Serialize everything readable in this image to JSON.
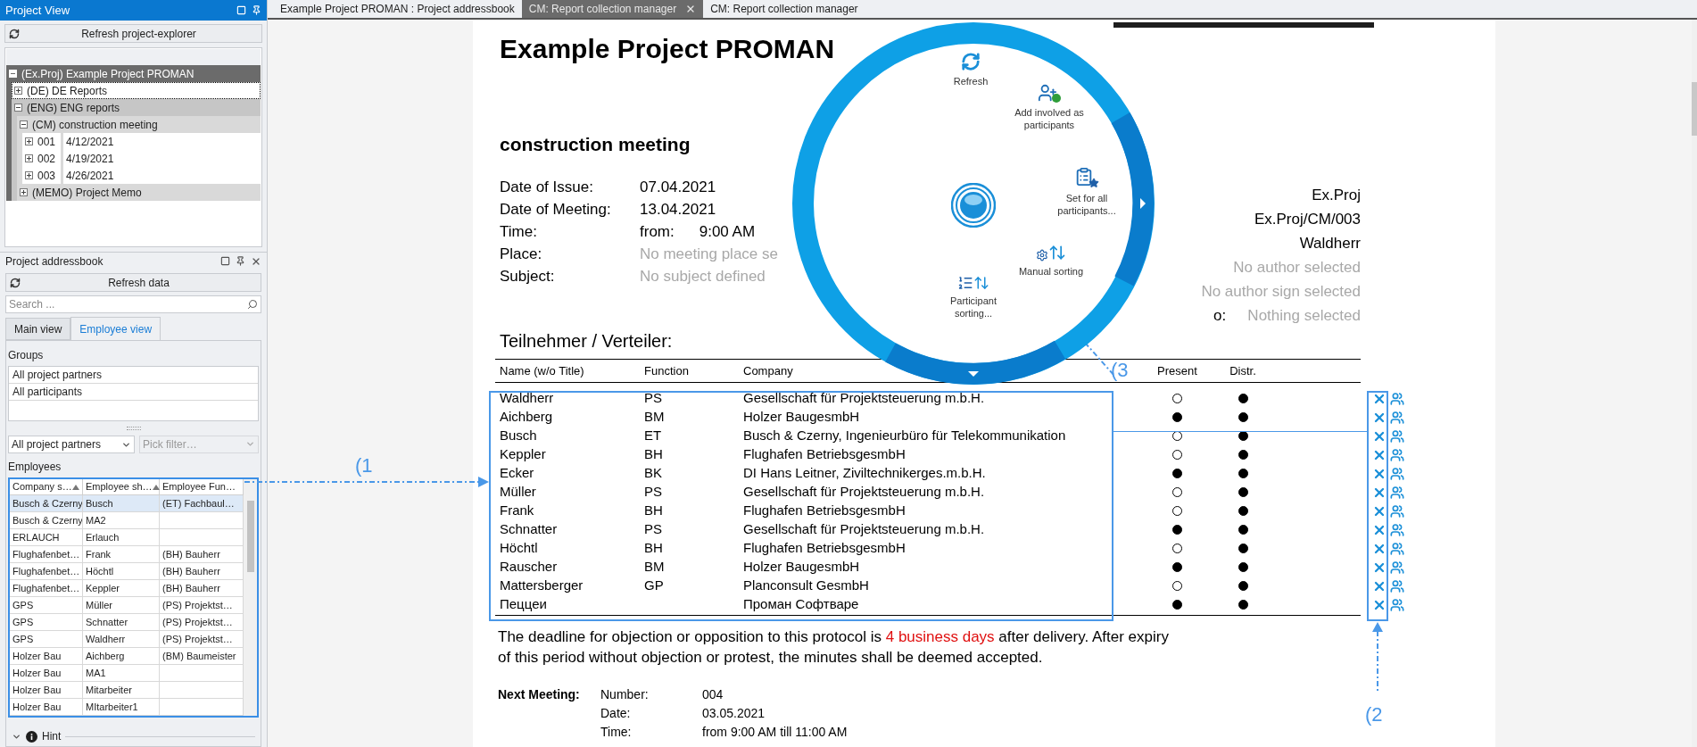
{
  "project_view": {
    "title": "Project View",
    "refresh_button": "Refresh project-explorer",
    "tree": [
      {
        "label": "(Ex.Proj) Example Project PROMAN",
        "expanded": true,
        "selected": false,
        "children": [
          {
            "label": "(DE) DE Reports",
            "expanded": false,
            "selected": true
          },
          {
            "label": "(ENG) ENG reports",
            "expanded": true,
            "selected": false,
            "children": [
              {
                "label": "(CM) construction meeting",
                "expanded": true,
                "selected": false,
                "children": [
                  {
                    "label": "001",
                    "date": "4/12/2021",
                    "expanded": false,
                    "selected": false
                  },
                  {
                    "label": "002",
                    "date": "4/19/2021",
                    "expanded": false,
                    "selected": false
                  },
                  {
                    "label": "003",
                    "date": "4/26/2021",
                    "expanded": false,
                    "selected": false
                  }
                ]
              },
              {
                "label": "(MEMO) Project Memo",
                "expanded": false,
                "selected": false
              }
            ]
          }
        ]
      }
    ]
  },
  "addressbook": {
    "title": "Project addressbook",
    "refresh_button": "Refresh data",
    "search": {
      "placeholder": "Search ..."
    },
    "tabs": [
      {
        "label": "Main view",
        "selected": false
      },
      {
        "label": "Employee view",
        "selected": true
      }
    ],
    "groups_label": "Groups",
    "groups": [
      "All project partners",
      "All participants"
    ],
    "filter": "All project partners",
    "pick_filter": {
      "placeholder": "Pick filter…"
    },
    "employees_label": "Employees",
    "employees": {
      "columns": [
        {
          "label": "Company s…",
          "sorted": true
        },
        {
          "label": "Employee sh…",
          "sorted": true
        },
        {
          "label": "Employee Fun…"
        }
      ],
      "rows": [
        {
          "cells": [
            "Busch & Czerny",
            "Busch",
            "(ET) Fachbaul…"
          ],
          "selected": true
        },
        {
          "cells": [
            "Busch & Czerny",
            "MA2",
            ""
          ],
          "selected": false
        },
        {
          "cells": [
            "ERLAUCH",
            "Erlauch",
            ""
          ],
          "selected": false
        },
        {
          "cells": [
            "Flughafenbet…",
            "Frank",
            "(BH) Bauherr"
          ],
          "selected": false
        },
        {
          "cells": [
            "Flughafenbet…",
            "Höchtl",
            "(BH) Bauherr"
          ],
          "selected": false
        },
        {
          "cells": [
            "Flughafenbet…",
            "Keppler",
            "(BH) Bauherr"
          ],
          "selected": false
        },
        {
          "cells": [
            "GPS",
            "Müller",
            "(PS) Projektst…"
          ],
          "selected": false
        },
        {
          "cells": [
            "GPS",
            "Schnatter",
            "(PS) Projektst…"
          ],
          "selected": false
        },
        {
          "cells": [
            "GPS",
            "Waldherr",
            "(PS) Projektst…"
          ],
          "selected": false
        },
        {
          "cells": [
            "Holzer Bau",
            "Aichberg",
            "(BM) Baumeister"
          ],
          "selected": false
        },
        {
          "cells": [
            "Holzer Bau",
            "MA1",
            ""
          ],
          "selected": false
        },
        {
          "cells": [
            "Holzer Bau",
            "Mitarbeiter",
            ""
          ],
          "selected": false
        },
        {
          "cells": [
            "Holzer Bau",
            "MItarbeiter1",
            ""
          ],
          "selected": false
        }
      ]
    },
    "hint": "Hint"
  },
  "document_tabs": [
    {
      "label": "Example Project PROMAN : Project addressbook",
      "selected": false
    },
    {
      "label": "CM: Report collection manager",
      "selected": true
    },
    {
      "label": "CM: Report collection manager",
      "selected": false
    }
  ],
  "report": {
    "title": "Example Project PROMAN",
    "subtitle": "construction meeting",
    "info": [
      {
        "label": "Date of Issue:",
        "value": "07.04.2021",
        "unset": false
      },
      {
        "label": "Date of Meeting:",
        "value": "13.04.2021",
        "unset": false
      },
      {
        "label": "Time:",
        "value": "from:",
        "extra": "9:00 AM",
        "unset": false
      },
      {
        "label": "Place:",
        "value": "No meeting place se",
        "unset": true
      },
      {
        "label": "Subject:",
        "value": "No subject defined",
        "unset": true
      }
    ],
    "right_info": [
      {
        "value": "Ex.Proj",
        "unset": false
      },
      {
        "value": "Ex.Proj/CM/003",
        "unset": false
      },
      {
        "value": "Waldherr",
        "unset": false
      },
      {
        "value": "No author selected",
        "unset": true
      },
      {
        "value": "No author sign selected",
        "unset": true
      },
      {
        "label": "o:",
        "value": "Nothing selected",
        "unset": true
      }
    ],
    "participants_heading": "Teilnehmer / Verteiler:",
    "columns": [
      "Name (w/o Title)",
      "Function",
      "Company",
      "Present",
      "Distr."
    ],
    "participants": [
      {
        "name": "Waldherr",
        "function": "PS",
        "company": "Gesellschaft für Projektsteuerung m.b.H.",
        "present": false,
        "distr": true
      },
      {
        "name": "Aichberg",
        "function": "BM",
        "company": "Holzer BaugesmbH",
        "present": true,
        "distr": true
      },
      {
        "name": "Busch",
        "function": "ET",
        "company": "Busch & Czerny, Ingenieurbüro für Telekommunikation",
        "present": false,
        "distr": true
      },
      {
        "name": "Keppler",
        "function": "BH",
        "company": "Flughafen BetriebsgesmbH",
        "present": false,
        "distr": true
      },
      {
        "name": "Ecker",
        "function": "BK",
        "company": "DI Hans Leitner, Ziviltechnikerges.m.b.H.",
        "present": true,
        "distr": true
      },
      {
        "name": "Müller",
        "function": "PS",
        "company": "Gesellschaft für Projektsteuerung m.b.H.",
        "present": false,
        "distr": true
      },
      {
        "name": "Frank",
        "function": "BH",
        "company": "Flughafen BetriebsgesmbH",
        "present": false,
        "distr": true
      },
      {
        "name": "Schnatter",
        "function": "PS",
        "company": "Gesellschaft für Projektsteuerung m.b.H.",
        "present": true,
        "distr": true
      },
      {
        "name": "Höchtl",
        "function": "BH",
        "company": "Flughafen BetriebsgesmbH",
        "present": false,
        "distr": true
      },
      {
        "name": "Rauscher",
        "function": "BM",
        "company": "Holzer BaugesmbH",
        "present": true,
        "distr": true
      },
      {
        "name": "Mattersberger",
        "function": "GP",
        "company": "Planconsult GesmbH",
        "present": false,
        "distr": true
      },
      {
        "name": "Пеццеи",
        "company": "Проман Софтваре",
        "present": true,
        "distr": true
      }
    ],
    "deadline": [
      {
        "text": "The deadline for objection or opposition to this protocol is ",
        "highlight": false
      },
      {
        "text": "4 business days",
        "highlight": true
      },
      {
        "text": " after delivery. After expiry of this period without objection or protest, the minutes shall be deemed accepted.",
        "highlight": false
      }
    ],
    "next_meeting": {
      "label": "Next Meeting:",
      "rows": [
        {
          "label": "Number:",
          "value": "004"
        },
        {
          "label": "Date:",
          "value": "03.05.2021"
        },
        {
          "label": "Time:",
          "value": "from 9:00 AM till 11:00 AM"
        }
      ]
    }
  },
  "radial_menu": {
    "items": [
      {
        "kind": "refresh",
        "label": "Refresh"
      },
      {
        "kind": "add",
        "label": "Add involved as participants"
      },
      {
        "kind": "set_all",
        "label": "Set for all participants..."
      },
      {
        "kind": "manual_sort",
        "label": "Manual sorting"
      },
      {
        "kind": "participant_sort",
        "label": "Participant sorting..."
      }
    ]
  },
  "callouts": [
    "(1",
    "(2",
    "(3"
  ]
}
